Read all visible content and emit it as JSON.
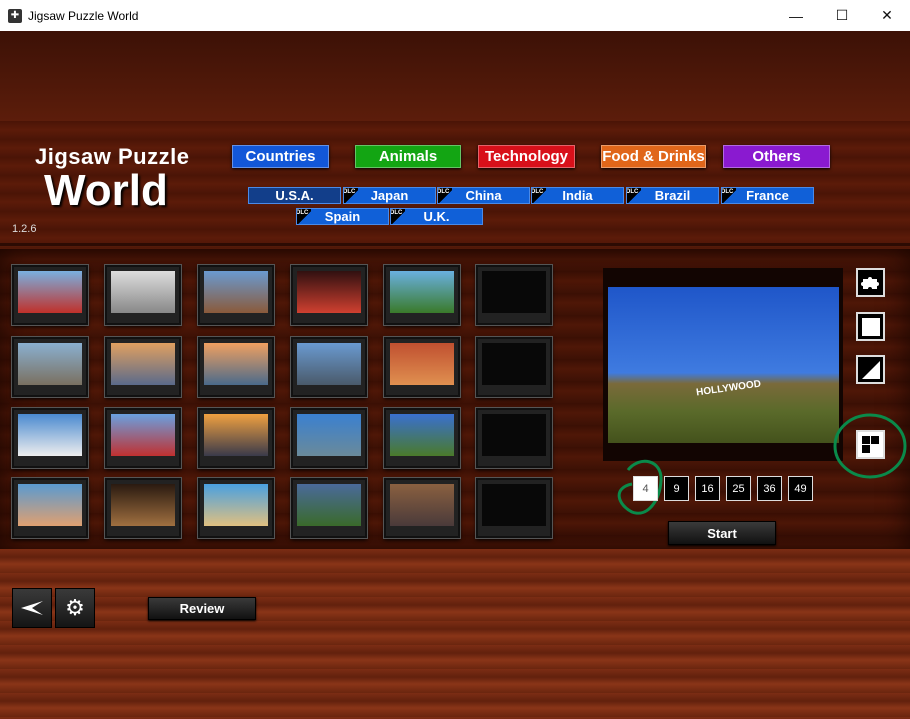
{
  "window": {
    "title": "Jigsaw Puzzle World",
    "minimize": "—",
    "maximize": "☐",
    "close": "✕"
  },
  "logo": {
    "line1": "Jigsaw Puzzle",
    "line2": "World"
  },
  "version": "1.2.6",
  "categories": [
    {
      "label": "Countries",
      "color": "#1257d8"
    },
    {
      "label": "Animals",
      "color": "#13a513"
    },
    {
      "label": "Technology",
      "color": "#d8101a"
    },
    {
      "label": "Food & Drinks",
      "color": "#e0661a"
    },
    {
      "label": "Others",
      "color": "#8a1ad0"
    }
  ],
  "countries": [
    {
      "label": "U.S.A.",
      "dlc": ""
    },
    {
      "label": "Japan",
      "dlc": "DLC"
    },
    {
      "label": "China",
      "dlc": "DLC"
    },
    {
      "label": "India",
      "dlc": "DLC"
    },
    {
      "label": "Brazil",
      "dlc": "DLC"
    },
    {
      "label": "France",
      "dlc": "DLC"
    },
    {
      "label": "Spain",
      "dlc": "DLC"
    },
    {
      "label": "U.K.",
      "dlc": "DLC"
    }
  ],
  "preview": {
    "sign": "HOLLYWOOD"
  },
  "piece_counts": [
    "4",
    "9",
    "16",
    "25",
    "36",
    "49"
  ],
  "selected_piece_count": "4",
  "start_label": "Start",
  "review_label": "Review"
}
